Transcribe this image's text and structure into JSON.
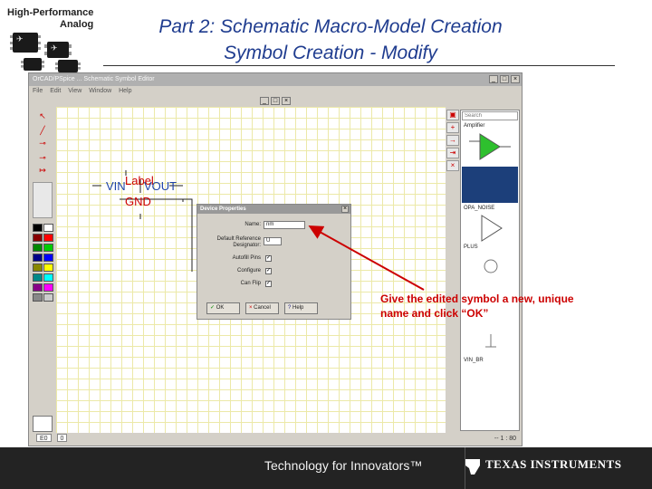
{
  "brand": {
    "line1": "High-Performance",
    "line2": "Analog",
    "chip_mark": "✈"
  },
  "slide": {
    "title_line1": "Part 2: Schematic Macro-Model Creation",
    "title_line2": "Symbol Creation - Modify"
  },
  "app": {
    "window_title": "OrCAD/PSpice ... Schematic Symbol Editor",
    "menu": [
      "File",
      "Edit",
      "View",
      "Window",
      "Help"
    ],
    "search_placeholder": "Search",
    "status": {
      "font_select": "E0",
      "layer_select": "0",
      "coords": "-- 1 : 80"
    },
    "panel_items": [
      "Amplifier",
      "OPA_NOISE",
      "PLUS",
      "VIN_BR"
    ]
  },
  "schematic": {
    "label": "Label",
    "vin": "VIN",
    "vout": "VOUT",
    "gnd": "GND"
  },
  "dialog": {
    "title": "Device Properties",
    "name_label": "Name:",
    "name_value": "nm",
    "desc_label": "Default Reference Designator:",
    "desc_value": "U",
    "autofill_label": "Autofill Pins",
    "configure_label": "Configure",
    "can_flip_label": "Can Flip",
    "ok": "OK",
    "cancel": "Cancel",
    "help": "Help"
  },
  "callout": {
    "text": "Give the edited symbol a new, unique name and click “OK”"
  },
  "footer": {
    "tagline": "Technology for Innovators™",
    "company": "TEXAS INSTRUMENTS"
  },
  "colors": {
    "title": "#1f3c8f",
    "callout": "#cc0000",
    "schematic_text": "#cc0000",
    "grid": "#ece9a8",
    "footer": "#232323"
  }
}
